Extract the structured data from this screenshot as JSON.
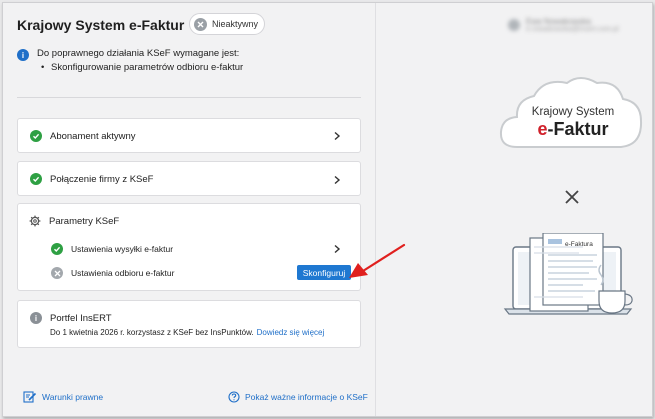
{
  "header": {
    "title": "Krajowy System e-Faktur",
    "status_badge": "Nieaktywny"
  },
  "user": {
    "name": "Ewa Nowakowska",
    "email": "e.nowakowska@insert.com.pl"
  },
  "notice": {
    "text": "Do poprawnego działania KSeF wymagane jest:",
    "bullet": "Skonfigurowanie parametrów odbioru e-faktur"
  },
  "cards": {
    "subscription": "Abonament aktywny",
    "connection": "Połączenie firmy z KSeF",
    "params": {
      "title": "Parametry KSeF",
      "send_settings": "Ustawienia wysyłki e-faktur",
      "receive_settings": "Ustawienia odbioru e-faktur",
      "configure_button": "Skonfiguruj"
    },
    "portfel": {
      "title": "Portfel InsERT",
      "text": "Do 1 kwietnia 2026 r. korzystasz z KSeF bez InsPunktów.",
      "link": "Dowiedz się więcej"
    }
  },
  "footer": {
    "legal": "Warunki prawne",
    "important_info": "Pokaż ważne informacje o KSeF"
  },
  "illustration": {
    "logo_line1": "Krajowy System",
    "logo_line2_e": "e",
    "logo_line2_rest": "-Faktur",
    "doc_title": "e-Faktura"
  },
  "colors": {
    "accent": "#1f78d1",
    "success": "#2ea043",
    "inactive": "#9aa0a6",
    "logo_red": "#d0202a",
    "arrow_red": "#e0201e"
  }
}
